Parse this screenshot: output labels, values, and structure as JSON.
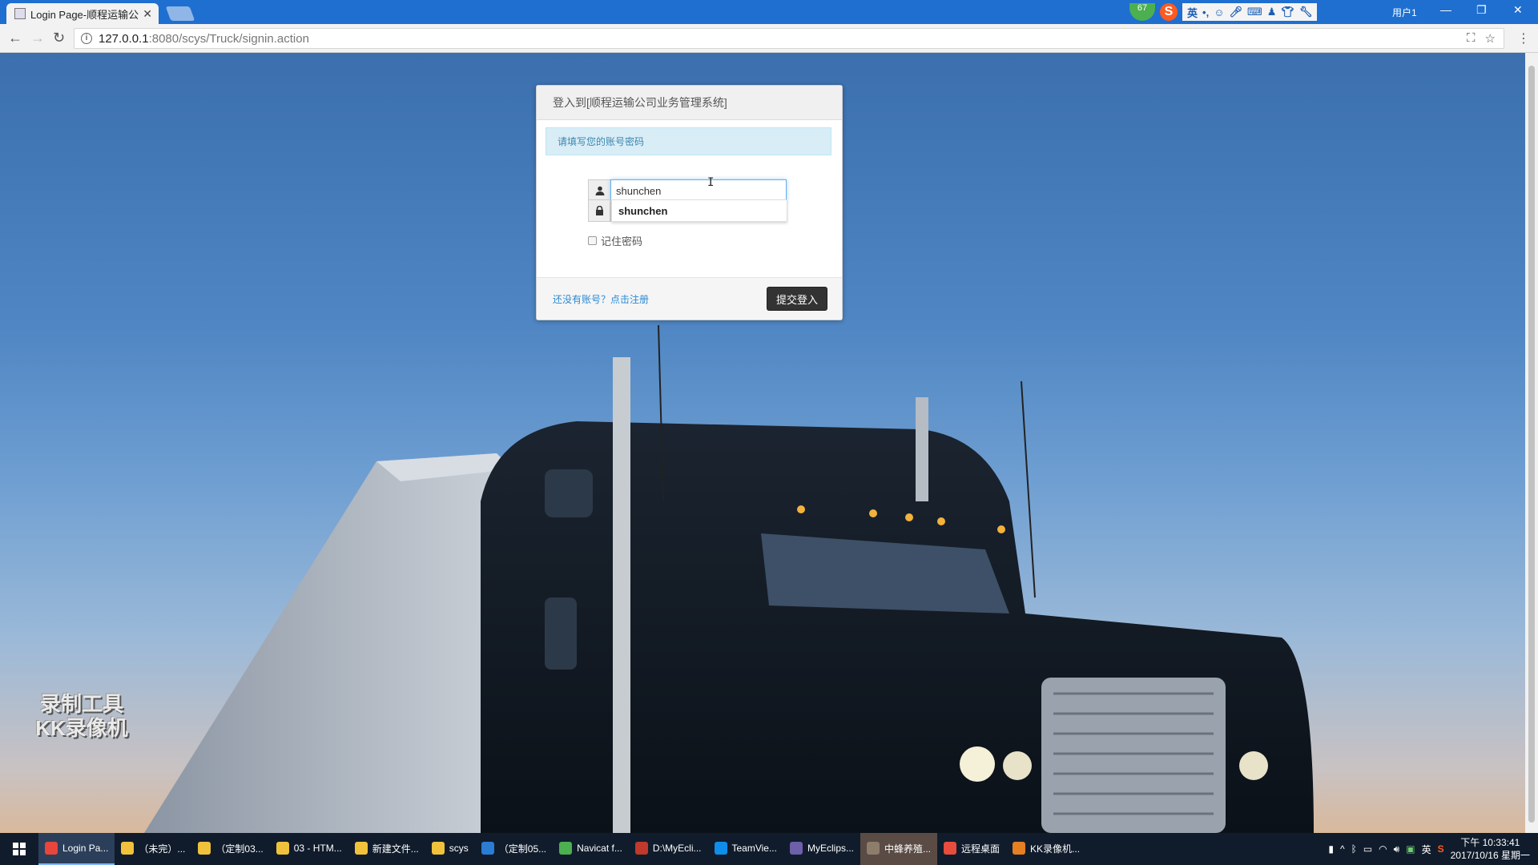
{
  "browser": {
    "tab_title": "Login Page-顺程运输公",
    "url_host": "127.0.0.1",
    "url_path": ":8080/scys/Truck/signin.action",
    "badge_count": "67",
    "ime_lang": "英",
    "user_label": "用户1"
  },
  "login": {
    "header": "登入到[顺程运输公司业务管理系统]",
    "alert": "请填写您的账号密码",
    "username_value": "shunchen",
    "autocomplete_suggestion": "shunchen",
    "remember_label": "记住密码",
    "register_link": "还没有账号？点击注册",
    "submit_label": "提交登入"
  },
  "watermark": {
    "line1": "录制工具",
    "line2": "KK录像机"
  },
  "taskbar": {
    "items": [
      {
        "label": "Login Pa...",
        "color": "#e8453c"
      },
      {
        "label": "（未完）...",
        "color": "#f0c23b"
      },
      {
        "label": "（定制03...",
        "color": "#f0c23b"
      },
      {
        "label": "03 - HTM...",
        "color": "#f0c23b"
      },
      {
        "label": "新建文件...",
        "color": "#f0c23b"
      },
      {
        "label": "scys",
        "color": "#f0c23b"
      },
      {
        "label": "（定制05...",
        "color": "#2b7cd3"
      },
      {
        "label": "Navicat f...",
        "color": "#4caf50"
      },
      {
        "label": "D:\\MyEcli...",
        "color": "#c0392b"
      },
      {
        "label": "TeamVie...",
        "color": "#0e8ee9"
      },
      {
        "label": "MyEclips...",
        "color": "#6d5fa8"
      },
      {
        "label": "中蜂养殖...",
        "color": "#8e7d6b"
      },
      {
        "label": "远程桌面",
        "color": "#e74c3c"
      },
      {
        "label": "KK录像机...",
        "color": "#e67e22"
      }
    ],
    "tray_lang": "英",
    "time": "下午 10:33:41",
    "date": "2017/10/16 星期一"
  }
}
